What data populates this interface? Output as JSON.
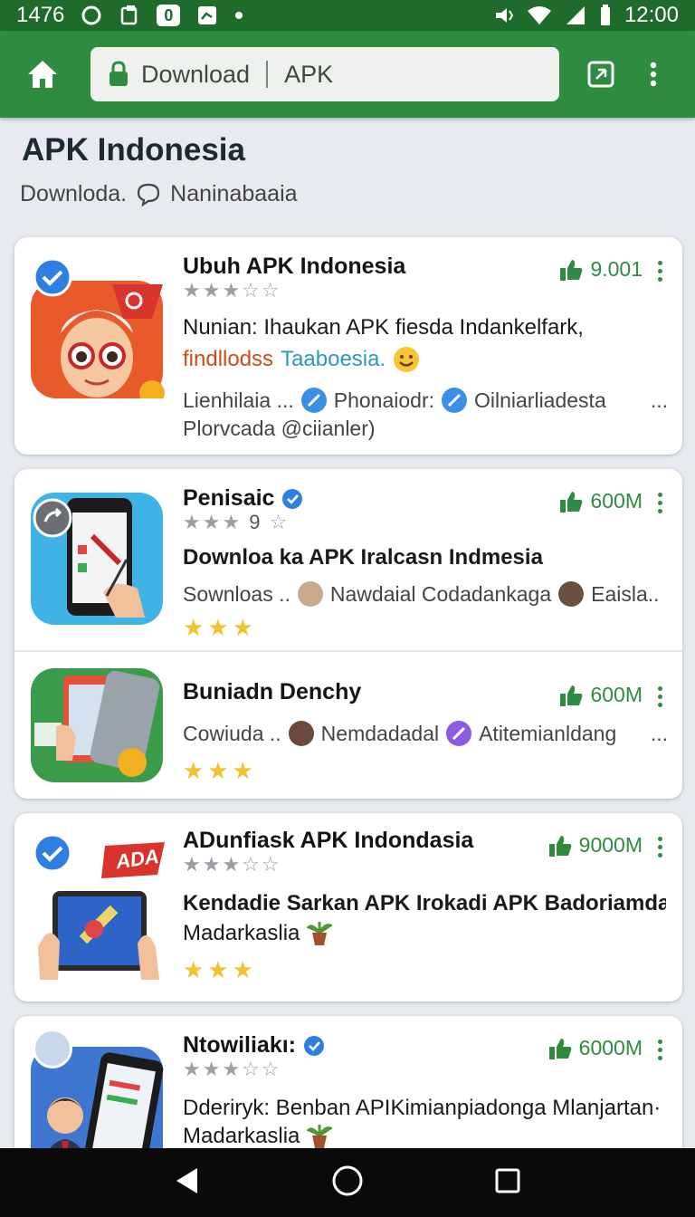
{
  "status_bar": {
    "left_text": "1476",
    "time": "12:00",
    "notification_count": "0"
  },
  "toolbar": {
    "url_left": "Download",
    "url_right": "APK"
  },
  "page": {
    "title": "APK Indonesia",
    "subtitle_left": "Downloda.",
    "subtitle_right": "Naninabaaia"
  },
  "apps": [
    {
      "name": "Ubuh APK Indonesia",
      "stars_text": "★★★☆☆",
      "likes": "9.001",
      "desc_line1": "Nunian: Ihaukan APK fiesda Indankelfark,",
      "desc_line2a": "findllodss",
      "desc_line2b": "Taaboesia.",
      "meta_1": "Lienhilaia ...",
      "meta_2": "Phonaiodr:",
      "meta_3": "Oilniarliadesta",
      "meta_more": "...",
      "meta_line2": "Plorvcada @ciianler)"
    },
    {
      "name": "Penisaic",
      "stars_text": "★★★",
      "stars_count": "9",
      "likes": "600М",
      "desc_line1": "Downloa ka APK Iralcasn Indmesia",
      "meta_1": "Sownloas ..",
      "meta_2": "Nawdaial Codadankaga",
      "meta_3": "Eaisla..",
      "gold_stars": "★★★"
    },
    {
      "name": "Buniadn Denchy",
      "likes": "600М",
      "meta_1": "Cowiuda ..",
      "meta_2": "Nemdadadal",
      "meta_3": "Atitemianldang",
      "meta_more": "...",
      "gold_stars": "★★★"
    },
    {
      "name": "ADunfiask APK Indondasia",
      "stars_text": "★★★☆☆",
      "likes": "9000М",
      "badge_text": "ADA",
      "desc_line1": "Kendadie Sarkan APK Irokadi APK Badoriamdal...",
      "desc_line2": "Madarkaslia",
      "gold_stars": "★★★"
    },
    {
      "name": "Ntowiliakı:",
      "stars_text": "★★★☆☆",
      "likes": "6000М",
      "desc_line1": "Dderiryk: Benban APIKimianpiadonga Mlanjartan·",
      "desc_line2": "Madarkaslia"
    }
  ],
  "colors": {
    "status_bar": "#1e6b2c",
    "app_bar": "#2e8b3f",
    "accent_green": "#2e8b3f",
    "verified_blue": "#2f7fe0",
    "background": "#e7eaee"
  },
  "icons": {
    "home": "home-icon",
    "lock": "lock-icon",
    "tabs": "tab-switcher-icon",
    "menu": "overflow-menu-icon",
    "thumbs_up": "thumbs-up-icon",
    "verified": "verified-check-icon",
    "nav_back": "back-icon",
    "nav_home": "home-circle-icon",
    "nav_recent": "recent-apps-icon"
  }
}
